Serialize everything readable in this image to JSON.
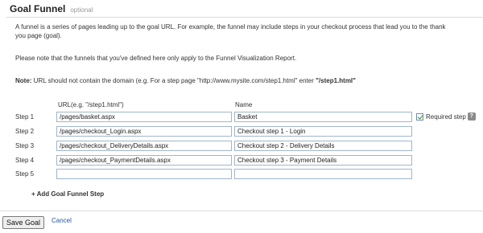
{
  "header": {
    "title": "Goal Funnel",
    "optional": "optional"
  },
  "description": {
    "line1": "A funnel is a series of pages leading up to the goal URL. For example, the funnel may include steps in your checkout process that lead you to the thank",
    "line2": "you page (goal).",
    "line3": "Please note that the funnels that you've defined here only apply to the Funnel Visualization Report.",
    "note_label": "Note:",
    "note_text": " URL should not contain the domain (e.g. For a step page \"http://www.mysite.com/step1.html\" enter ",
    "note_example": "\"/step1.html\""
  },
  "columns": {
    "url": "URL(e.g. \"/step1.html\")",
    "name": "Name"
  },
  "steps": [
    {
      "label": "Step 1",
      "url": "/pages/basket.aspx",
      "name": "Basket"
    },
    {
      "label": "Step 2",
      "url": "/pages/checkout_Login.aspx",
      "name": "Checkout step 1 - Login"
    },
    {
      "label": "Step 3",
      "url": "/pages/checkout_DeliveryDetails.aspx",
      "name": "Checkout step 2 - Delivery Details"
    },
    {
      "label": "Step 4",
      "url": "/pages/checkout_PaymentDetails.aspx",
      "name": "Checkout step 3 - Payment Details"
    },
    {
      "label": "Step 5",
      "url": "",
      "name": ""
    }
  ],
  "required_step": {
    "label": "Required step",
    "checked": true,
    "help_icon": "?"
  },
  "add_step": "+ Add Goal Funnel Step",
  "actions": {
    "save": "Save Goal",
    "cancel": "Cancel"
  },
  "colors": {
    "link": "#2256a9",
    "field_border": "#9fb6cd",
    "divider": "#dcdcdc"
  }
}
